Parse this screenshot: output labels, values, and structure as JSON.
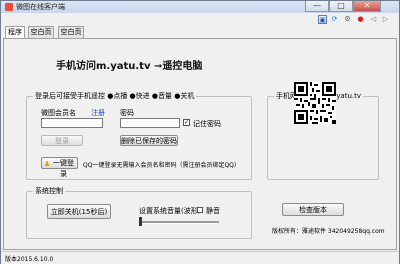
{
  "window": {
    "title": "微图在线客户端",
    "minimize": "—",
    "maximize": "□",
    "close": "✕"
  },
  "tabs": [
    {
      "label": "程序"
    },
    {
      "label": "空白页"
    },
    {
      "label": "空白页"
    }
  ],
  "headline": "手机访问m.yatu.tv ➞遥控电脑",
  "login_group": {
    "legend": "登录后可接受手机遥控 ●点播 ●快进 ●音量 ●关机",
    "username_label": "微图会员名",
    "register_link": "注册",
    "password_label": "密码",
    "username_value": "",
    "password_value": "",
    "remember_label": "记住密码",
    "remember_checked": true,
    "login_button": "登录",
    "delete_saved_button": "删除已保存的密码",
    "quick_login_button": "一键登录",
    "quick_login_note": "QQ一键登录无需输入会员名和密码（需注册会员绑定QQ）"
  },
  "qr_group": {
    "legend": "手机网址二维码 m.yatu.tv",
    "qr_icon": "qr-code"
  },
  "system_group": {
    "legend": "系统控制",
    "shutdown_button": "立即关机(15秒后)",
    "volume_label": "设置系统音量(波形)",
    "mute_label": "静音",
    "mute_checked": false,
    "volume_level": 0.0
  },
  "check_version_button": "检查版本",
  "copyright": "版权所有：雅途软件 342049258qq.com",
  "status_version": "版本2015.6.10.0",
  "colors": {
    "accent_link": "#1a3fd0",
    "close_button": "#c75050"
  }
}
